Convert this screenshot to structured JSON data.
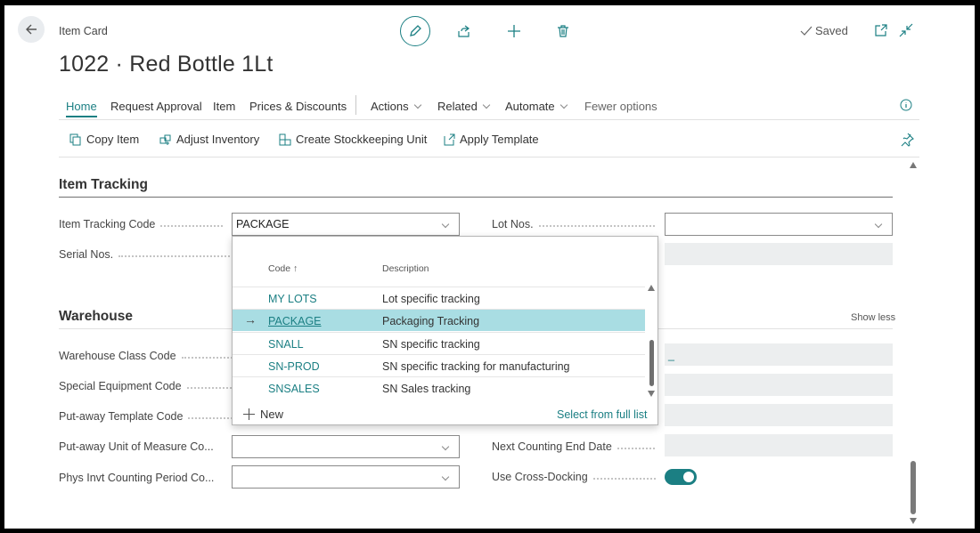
{
  "header": {
    "card_label": "Item Card",
    "title": "1022 · Red Bottle 1Lt",
    "saved_status": "Saved",
    "icons": [
      "back-arrow-icon",
      "pencil-icon",
      "share-icon",
      "plus-icon",
      "trash-icon",
      "check-icon",
      "popout-icon",
      "collapse-icon"
    ]
  },
  "nav": {
    "items": [
      {
        "label": "Home",
        "active": true
      },
      {
        "label": "Request Approval"
      },
      {
        "label": "Item"
      },
      {
        "label": "Prices & Discounts"
      },
      {
        "label": "Actions"
      },
      {
        "label": "Related"
      },
      {
        "label": "Automate"
      },
      {
        "label": "Fewer options"
      }
    ]
  },
  "commands": [
    {
      "label": "Copy Item",
      "icon": "copy-icon"
    },
    {
      "label": "Adjust Inventory",
      "icon": "adjust-inventory-icon"
    },
    {
      "label": "Create Stockkeeping Unit",
      "icon": "stockkeeping-icon"
    },
    {
      "label": "Apply Template",
      "icon": "template-icon"
    }
  ],
  "item_tracking": {
    "title": "Item Tracking",
    "item_tracking_code_label": "Item Tracking Code",
    "item_tracking_code_value": "PACKAGE",
    "lot_nos_label": "Lot Nos.",
    "serial_nos_label": "Serial Nos."
  },
  "lookup": {
    "col_code": "Code ↑",
    "col_description": "Description",
    "rows": [
      {
        "code": "MY LOTS",
        "description": "Lot specific tracking"
      },
      {
        "code": "PACKAGE",
        "description": "Packaging Tracking",
        "selected": true
      },
      {
        "code": "SNALL",
        "description": "SN specific tracking"
      },
      {
        "code": "SN-PROD",
        "description": "SN specific tracking for manufacturing"
      },
      {
        "code": "SNSALES",
        "description": "SN Sales tracking"
      }
    ],
    "new_label": "New",
    "full_list_label": "Select from full list"
  },
  "warehouse": {
    "title": "Warehouse",
    "show_less": "Show less",
    "warehouse_class_code_label": "Warehouse Class Code",
    "special_equipment_code_label": "Special Equipment Code",
    "putaway_template_code_label": "Put-away Template Code",
    "putaway_uom_label": "Put-away Unit of Measure Co...",
    "phys_invt_label": "Phys Invt Counting Period Co...",
    "readonly_value": "_",
    "next_counting_end_label": "Next Counting End Date",
    "cross_docking_label": "Use Cross-Docking",
    "cross_docking_on": true
  },
  "colors": {
    "accent": "#1b7f83",
    "selected_row": "#a9dde3",
    "readonly_field": "#eceeef"
  }
}
